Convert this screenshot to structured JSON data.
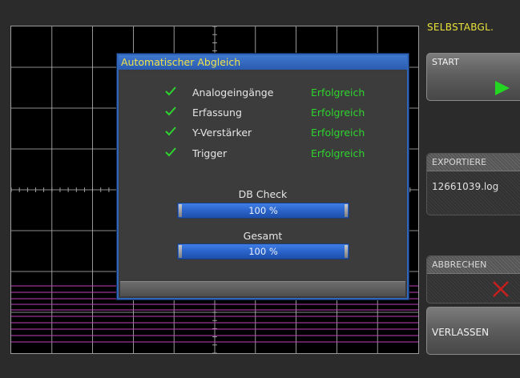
{
  "menu": {
    "title": "SELBSTABGL.",
    "start_label": "START",
    "export_label": "EXPORTIERE",
    "export_value": "12661039.log",
    "abort_label": "ABBRECHEN",
    "exit_label": "VERLASSEN"
  },
  "dialog": {
    "title": "Automatischer Abgleich",
    "steps": [
      {
        "name": "Analogeingänge",
        "result": "Erfolgreich"
      },
      {
        "name": "Erfassung",
        "result": "Erfolgreich"
      },
      {
        "name": "Y-Verstärker",
        "result": "Erfolgreich"
      },
      {
        "name": "Trigger",
        "result": "Erfolgreich"
      }
    ],
    "db_check": {
      "label": "DB Check",
      "percent_text": "100 %",
      "fraction": 1.0
    },
    "total": {
      "label": "Gesamt",
      "percent_text": "100 %",
      "fraction": 1.0
    }
  },
  "colors": {
    "accent_yellow": "#e8e23a",
    "success_green": "#2ed42e",
    "play_green": "#22d622",
    "abort_red": "#c81e1e",
    "dialog_blue": "#2f66b8",
    "trace_magenta": "#c03fc0"
  },
  "icons": {
    "start": "play-icon",
    "abort": "x-icon",
    "step_ok": "checkmark-icon"
  }
}
